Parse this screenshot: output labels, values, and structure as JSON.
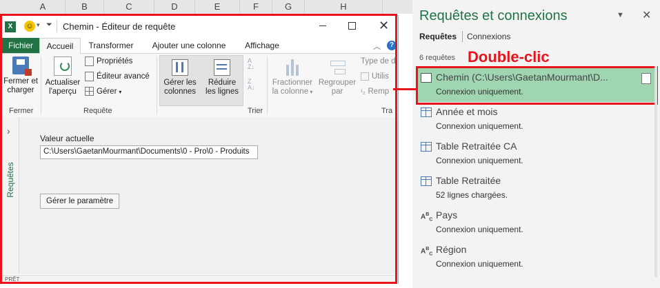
{
  "excel": {
    "columns": [
      "A",
      "B",
      "C",
      "D",
      "E",
      "F",
      "G",
      "H"
    ],
    "status": "PRÊT"
  },
  "editor": {
    "title": "Chemin - Éditeur de requête",
    "tabs": [
      "Fichier",
      "Accueil",
      "Transformer",
      "Ajouter une colonne",
      "Affichage"
    ],
    "ribbon": {
      "close_load": "Fermer et charger",
      "refresh": "Actualiser l'aperçu",
      "properties": "Propriétés",
      "advanced_editor": "Éditeur avancé",
      "manage": "Gérer",
      "manage_columns": "Gérer les colonnes",
      "reduce_rows": "Réduire les lignes",
      "split_column": "Fractionner la colonne",
      "group_by": "Regrouper par",
      "data_type": "Type de d",
      "use_first": "Utilis",
      "replace": "Remp",
      "group_fermer": "Fermer",
      "group_requete": "Requête",
      "group_trier": "Trier",
      "group_tra": "Tra"
    },
    "side_label": "Requêtes",
    "content": {
      "current_value_label": "Valeur actuelle",
      "current_value": "C:\\Users\\GaetanMourmant\\Documents\\0 - Pro\\0 - Produits",
      "manage_param_button": "Gérer le paramètre"
    }
  },
  "pane": {
    "title": "Requêtes et connexions",
    "tab_queries": "Requêtes",
    "tab_connections": "Connexions",
    "count": "6 requêtes",
    "annotation": "Double-clic",
    "queries": [
      {
        "name": "Chemin (C:\\Users\\GaetanMourmant\\D...",
        "sub": "Connexion uniquement.",
        "icon": "parameter-icon"
      },
      {
        "name": "Année et mois",
        "sub": "Connexion uniquement.",
        "icon": "table-icon"
      },
      {
        "name": "Table Retraitée CA",
        "sub": "Connexion uniquement.",
        "icon": "table-icon"
      },
      {
        "name": "Table Retraitée",
        "sub": "52 lignes chargées.",
        "icon": "table-icon"
      },
      {
        "name": "Pays",
        "sub": "Connexion uniquement.",
        "icon": "abc-icon"
      },
      {
        "name": "Région",
        "sub": "Connexion uniquement.",
        "icon": "abc-icon"
      }
    ]
  },
  "colors": {
    "accent_green": "#217346",
    "highlight": "#9fd5b1",
    "annotation_red": "#e8141b"
  }
}
